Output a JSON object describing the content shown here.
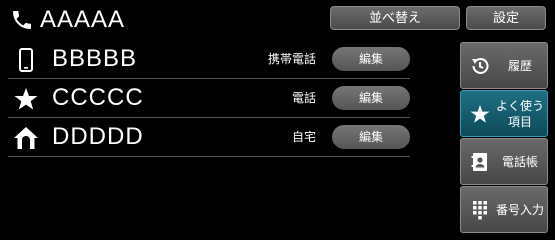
{
  "header": {
    "title": "AAAAA",
    "icon": "phone-icon",
    "sort_label": "並べ替え",
    "settings_label": "設定"
  },
  "contacts": [
    {
      "name": "BBBBB",
      "type": "携帯電話",
      "icon": "mobile-phone-icon",
      "edit_label": "編集"
    },
    {
      "name": "CCCCC",
      "type": "電話",
      "icon": "star-icon",
      "edit_label": "編集"
    },
    {
      "name": "DDDDD",
      "type": "自宅",
      "icon": "home-icon",
      "edit_label": "編集"
    }
  ],
  "sidebar": {
    "items": [
      {
        "label": "履歴",
        "icon": "history-icon",
        "active": false
      },
      {
        "label": "よく使う\n項目",
        "icon": "star-icon",
        "active": true
      },
      {
        "label": "電話帳",
        "icon": "phonebook-icon",
        "active": false
      },
      {
        "label": "番号入力",
        "icon": "keypad-icon",
        "active": false
      }
    ]
  },
  "colors": {
    "background": "#000000",
    "button": "#5a5a5a",
    "active_tab": "#0d4a5a"
  }
}
